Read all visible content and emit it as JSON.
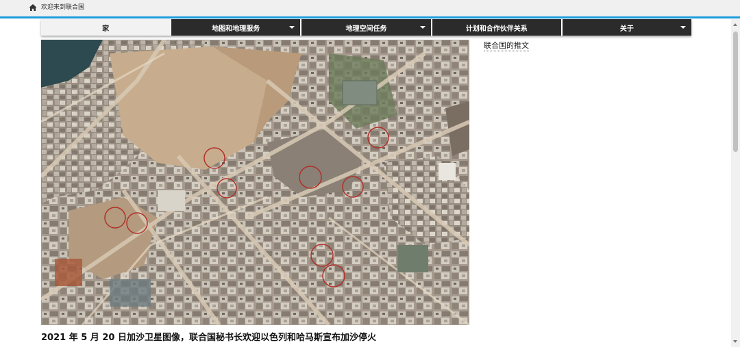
{
  "header": {
    "welcome_text": "欢迎来到联合国",
    "home_icon": "home-icon"
  },
  "nav": {
    "items": [
      {
        "label": "家",
        "active": true,
        "has_dropdown": false
      },
      {
        "label": "地图和地理服务",
        "active": false,
        "has_dropdown": true
      },
      {
        "label": "地理空间任务",
        "active": false,
        "has_dropdown": true
      },
      {
        "label": "计划和合作伙伴关系",
        "active": false,
        "has_dropdown": false
      },
      {
        "label": "关于",
        "active": false,
        "has_dropdown": true
      }
    ]
  },
  "main": {
    "caption": "2021 年 5 月 20 日加沙卫星图像，联合国秘书长欢迎以色列和哈马斯宣布加沙停火"
  },
  "sidebar": {
    "tweets_link": "联合国的推文"
  },
  "colors": {
    "accent": "#1a9bdb",
    "nav_bg": "#2b2b2b",
    "nav_active_bg": "#f2f2f2"
  }
}
